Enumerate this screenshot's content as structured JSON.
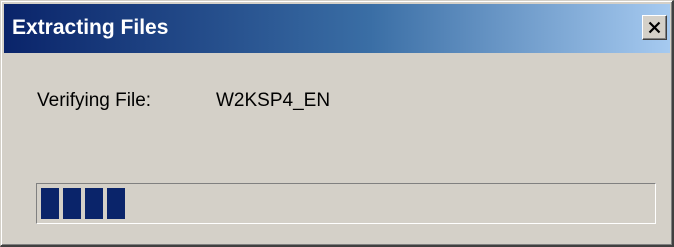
{
  "window": {
    "title": "Extracting Files",
    "close_label": "Close"
  },
  "status": {
    "label": "Verifying File:",
    "value": "W2KSP4_EN"
  },
  "progress": {
    "fraction": 0.15,
    "color": "#0a246a"
  },
  "colors": {
    "title_gradient_start": "#0a246a",
    "title_gradient_end": "#a6caf0",
    "face": "#d4d0c8"
  },
  "icons": {
    "close": "close-icon"
  }
}
